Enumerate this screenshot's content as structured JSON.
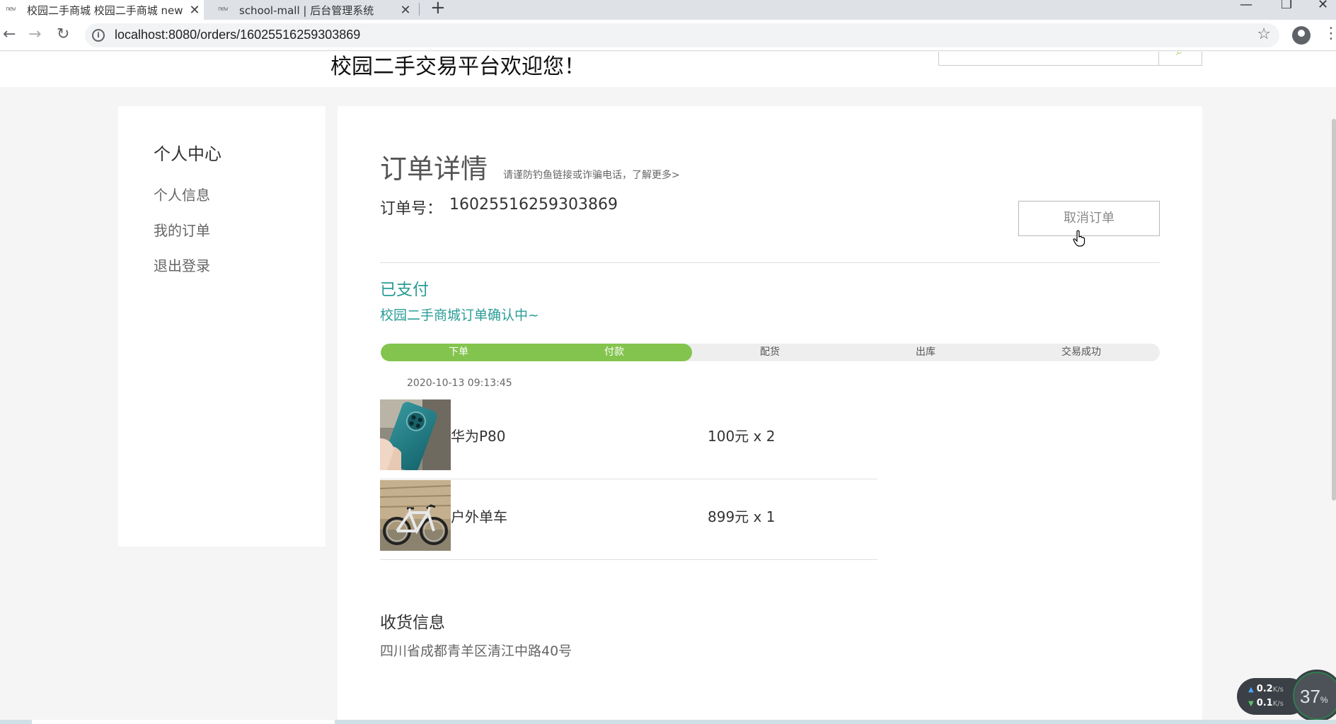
{
  "browser": {
    "tabs": [
      {
        "title": "校园二手商城 校园二手商城 new",
        "favicon": "new"
      },
      {
        "title": "school-mall | 后台管理系统",
        "favicon": "new"
      }
    ],
    "url": "localhost:8080/orders/16025516259303869"
  },
  "header": {
    "welcome": "校园二手交易平台欢迎您！"
  },
  "sidebar": {
    "title": "个人中心",
    "items": [
      {
        "label": "个人信息"
      },
      {
        "label": "我的订单"
      },
      {
        "label": "退出登录"
      }
    ]
  },
  "order": {
    "title": "订单详情",
    "tip": "请谨防钓鱼链接或诈骗电话，了解更多>",
    "number_label": "订单号：",
    "number": "16025516259303869",
    "cancel_label": "取消订单",
    "status": "已支付",
    "status_message": "校园二手商城订单确认中~",
    "steps": [
      {
        "label": "下单",
        "done": true
      },
      {
        "label": "付款",
        "done": true
      },
      {
        "label": "配货",
        "done": false
      },
      {
        "label": "出库",
        "done": false
      },
      {
        "label": "交易成功",
        "done": false
      }
    ],
    "progress_fraction": 0.4,
    "time": "2020-10-13 09:13:45",
    "items": [
      {
        "name": "华为P80",
        "price": "100元 x 2",
        "image": "teal-phone-photo"
      },
      {
        "name": "户外单车",
        "price": "899元 x 1",
        "image": "bicycle-photo"
      }
    ],
    "shipping_title": "收货信息",
    "shipping_address": "四川省成都青羊区清江中路40号"
  },
  "network_widget": {
    "upload": "0.2",
    "download": "0.1",
    "unit": "K/s",
    "percent": "37",
    "percent_sign": "%"
  },
  "colors": {
    "accent_green": "#83c44e",
    "status_teal": "#2a9d96"
  }
}
